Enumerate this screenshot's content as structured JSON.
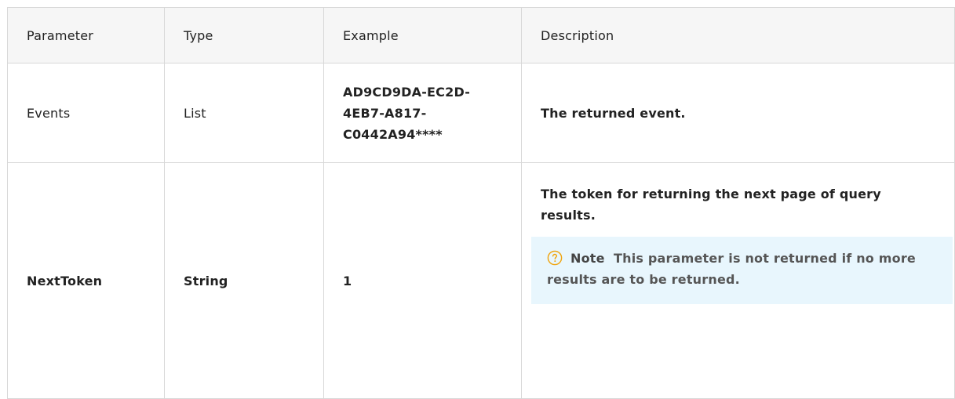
{
  "table": {
    "headers": [
      "Parameter",
      "Type",
      "Example",
      "Description"
    ],
    "rows": [
      {
        "parameter": "Events",
        "type": "List",
        "example": "AD9CD9DA-EC2D-4EB7-A817-C0442A94****",
        "description": "The returned event."
      },
      {
        "parameter": "NextToken",
        "type": "String",
        "example": "1",
        "description": "The token for returning the next page of query results.",
        "note_label": "Note",
        "note_text": "This parameter is not returned if no more results are to be returned."
      }
    ]
  },
  "icons": {
    "note": "question-circle-icon"
  },
  "colors": {
    "note_bg": "#e8f6fd",
    "note_icon": "#f0a30a",
    "border": "#d8d8d8",
    "header_bg": "#f6f6f6"
  }
}
